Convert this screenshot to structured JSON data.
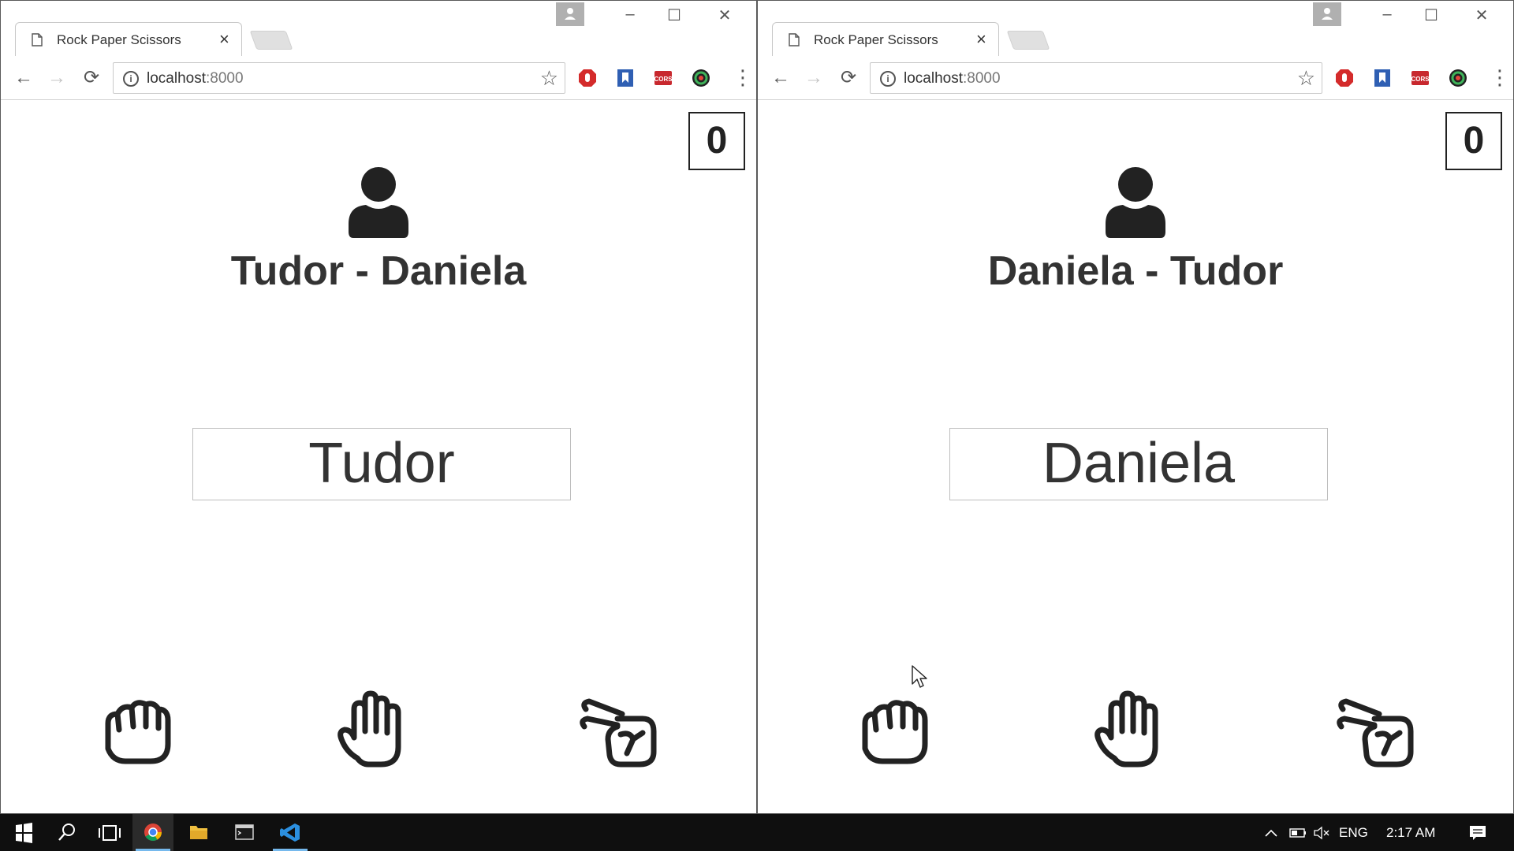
{
  "windows": [
    {
      "tab_title": "Rock Paper Scissors",
      "url_host": "localhost",
      "url_port": ":8000",
      "score": "0",
      "match_title": "Tudor - Daniela",
      "player_name": "Tudor"
    },
    {
      "tab_title": "Rock Paper Scissors",
      "url_host": "localhost",
      "url_port": ":8000",
      "score": "0",
      "match_title": "Daniela - Tudor",
      "player_name": "Daniela"
    }
  ],
  "icons": {
    "choices": [
      "rock-hand-icon",
      "paper-hand-icon",
      "scissors-hand-icon"
    ],
    "avatar": "user-icon"
  },
  "taskbar": {
    "language": "ENG",
    "time": "2:17 AM"
  },
  "colors": {
    "accent": "#76b9ed",
    "text": "#333333",
    "taskbar": "#0f0f0f"
  }
}
